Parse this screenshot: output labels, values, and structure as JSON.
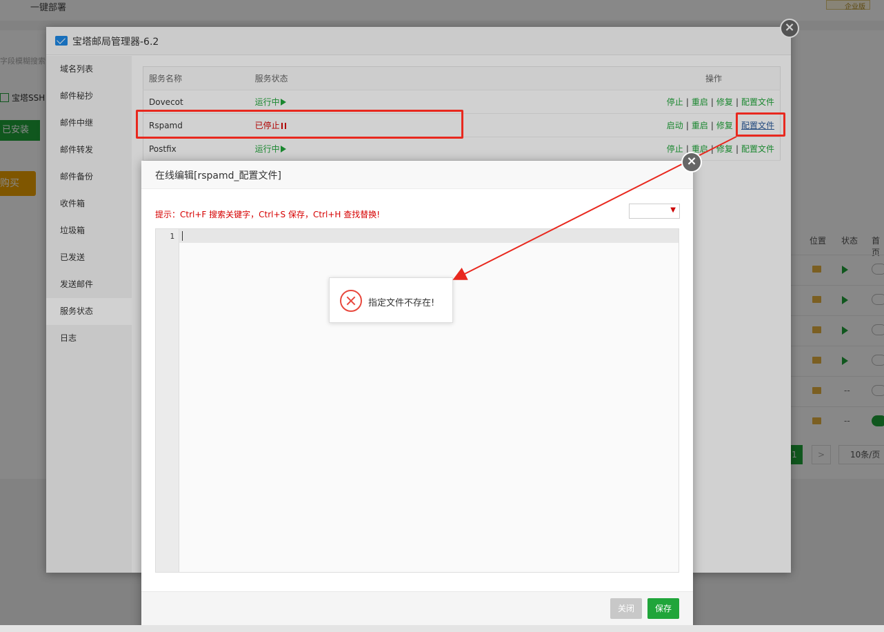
{
  "background": {
    "top_title": "一键部署",
    "enterprise_badge": "企业版",
    "search_placeholder": "字段模糊搜索",
    "ssh_label": "宝塔SSH",
    "installed_button": "已安装",
    "buy_button": "购买",
    "table_headers": [
      "位置",
      "状态",
      "首页"
    ],
    "rows": [
      {
        "status": "play",
        "toggle": "off"
      },
      {
        "status": "play",
        "toggle": "off"
      },
      {
        "status": "play",
        "toggle": "off"
      },
      {
        "status": "play",
        "toggle": "off"
      },
      {
        "status": "--",
        "toggle": "off"
      },
      {
        "status": "--",
        "toggle": "on"
      }
    ],
    "pager": {
      "current": "1",
      "next": ">",
      "page_size": "10条/页"
    }
  },
  "mail_dialog": {
    "title": "宝塔邮局管理器-6.2",
    "sidebar": [
      {
        "label": "域名列表"
      },
      {
        "label": "邮件秘抄"
      },
      {
        "label": "邮件中继"
      },
      {
        "label": "邮件转发"
      },
      {
        "label": "邮件备份"
      },
      {
        "label": "收件箱"
      },
      {
        "label": "垃圾箱"
      },
      {
        "label": "已发送"
      },
      {
        "label": "发送邮件"
      },
      {
        "label": "服务状态"
      },
      {
        "label": "日志"
      }
    ],
    "active_sidebar_index": 9,
    "table": {
      "headers": {
        "name": "服务名称",
        "status": "服务状态",
        "ops": "操作"
      },
      "rows": [
        {
          "name": "Dovecot",
          "status": "运行中",
          "state": "running",
          "ops": [
            "停止",
            "重启",
            "修复",
            "配置文件"
          ]
        },
        {
          "name": "Rspamd",
          "status": "已停止",
          "state": "stopped",
          "ops": [
            "启动",
            "重启",
            "修复",
            "配置文件"
          ]
        },
        {
          "name": "Postfix",
          "status": "运行中",
          "state": "running",
          "ops": [
            "停止",
            "重启",
            "修复",
            "配置文件"
          ]
        }
      ]
    }
  },
  "editor_dialog": {
    "title": "在线编辑[rspamd_配置文件]",
    "tip": "提示：Ctrl+F 搜索关键字，Ctrl+S 保存，Ctrl+H 查找替换!",
    "encoding_value": "",
    "line_number": "1",
    "close_button": "关闭",
    "save_button": "保存"
  },
  "toast": {
    "message": "指定文件不存在!"
  },
  "colors": {
    "green": "#20a53a",
    "red": "#d60000",
    "annotation": "#e8281e"
  }
}
